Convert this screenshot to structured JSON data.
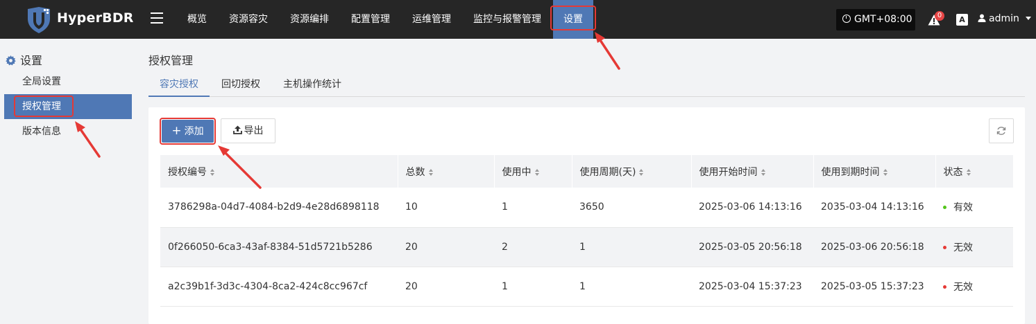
{
  "brand": {
    "name": "HyperBDR"
  },
  "nav": {
    "items": [
      {
        "label": "概览"
      },
      {
        "label": "资源容灾"
      },
      {
        "label": "资源编排"
      },
      {
        "label": "配置管理"
      },
      {
        "label": "运维管理"
      },
      {
        "label": "监控与报警管理"
      },
      {
        "label": "设置",
        "active": true
      }
    ],
    "timezone": "GMT+08:00",
    "alert_count": "0",
    "lang_icon": "A",
    "user": "admin"
  },
  "sidebar": {
    "title": "设置",
    "items": [
      {
        "label": "全局设置"
      },
      {
        "label": "授权管理",
        "active": true
      },
      {
        "label": "版本信息"
      }
    ]
  },
  "main": {
    "title": "授权管理",
    "tabs": [
      {
        "label": "容灾授权",
        "active": true
      },
      {
        "label": "回切授权"
      },
      {
        "label": "主机操作统计"
      }
    ],
    "toolbar": {
      "add_label": "添加",
      "export_label": "导出"
    },
    "table": {
      "columns": [
        "授权编号",
        "总数",
        "使用中",
        "使用周期(天)",
        "使用开始时间",
        "使用到期时间",
        "状态"
      ],
      "rows": [
        {
          "id": "3786298a-04d7-4084-b2d9-4e28d6898118",
          "total": "10",
          "in_use": "1",
          "period": "3650",
          "start": "2025-03-06 14:13:16",
          "end": "2035-03-04 14:13:16",
          "status": "有效",
          "status_color": "#52c41a"
        },
        {
          "id": "0f266050-6ca3-43af-8384-51d5721b5286",
          "total": "20",
          "in_use": "2",
          "period": "1",
          "start": "2025-03-05 20:56:18",
          "end": "2025-03-06 20:56:18",
          "status": "无效",
          "status_color": "#e53935"
        },
        {
          "id": "a2c39b1f-3d3c-4304-8ca2-424c8cc967cf",
          "total": "20",
          "in_use": "1",
          "period": "1",
          "start": "2025-03-04 15:37:23",
          "end": "2025-03-05 15:37:23",
          "status": "无效",
          "status_color": "#e53935"
        }
      ]
    }
  },
  "colors": {
    "accent": "#4f78b5",
    "topbar": "#262626",
    "highlight": "#e53935"
  }
}
